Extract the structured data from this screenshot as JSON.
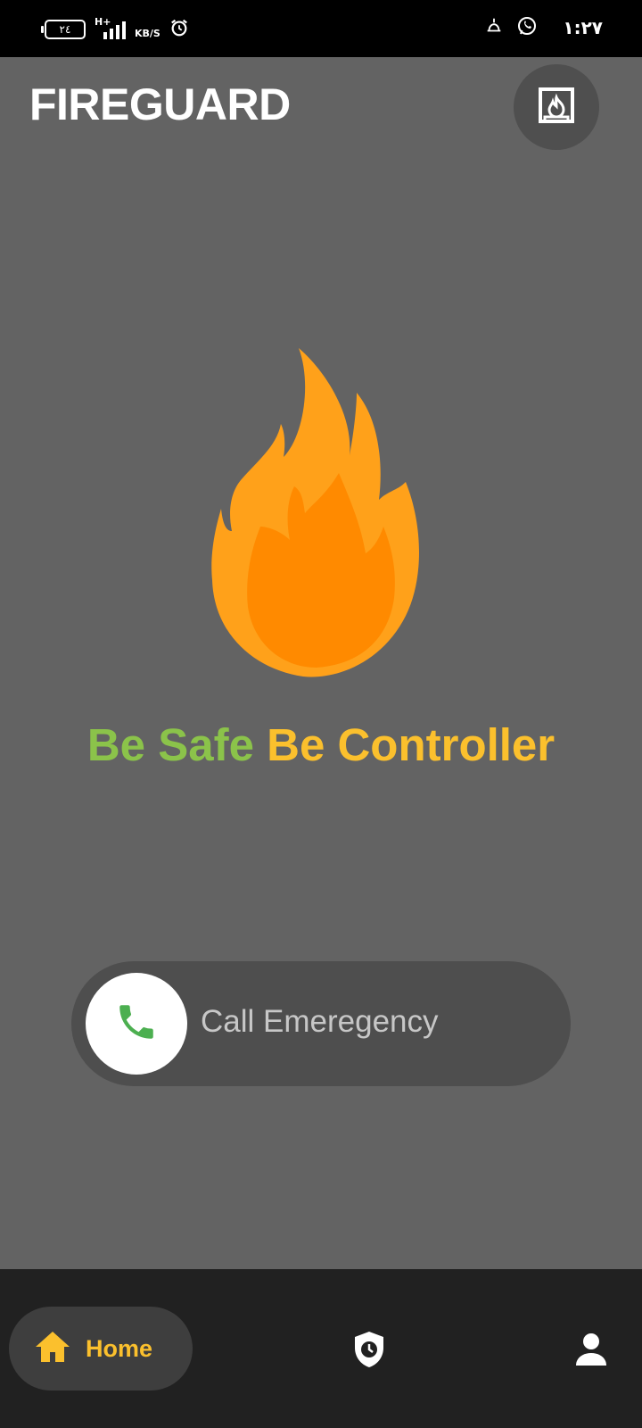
{
  "status_bar": {
    "battery": "٢٤",
    "network": "H+",
    "speed": "KB/S",
    "time": "١:٢٧",
    "icons": [
      "battery-icon",
      "signal-icon",
      "alarm-icon",
      "prayer-icon",
      "whatsapp-icon"
    ]
  },
  "header": {
    "title": "FIREGUARD",
    "corner_icon": "fireplace-icon"
  },
  "hero": {
    "icon": "flame-icon",
    "tagline_part1": "Be Safe",
    "tagline_part2": "Be Controller"
  },
  "call": {
    "label": "Call Emeregency",
    "icon": "phone-icon"
  },
  "bottom_nav": {
    "items": [
      {
        "label": "Home",
        "icon": "home-icon",
        "active": true
      },
      {
        "label": "",
        "icon": "shield-clock-icon",
        "active": false
      },
      {
        "label": "",
        "icon": "person-icon",
        "active": false
      }
    ]
  },
  "colors": {
    "background": "#636363",
    "accent_yellow": "#fbc02d",
    "accent_green": "#8bc34a",
    "flame_outer": "#ffa11a",
    "flame_inner": "#ff8a00",
    "phone_green": "#4caf50",
    "nav_background": "#212121"
  }
}
